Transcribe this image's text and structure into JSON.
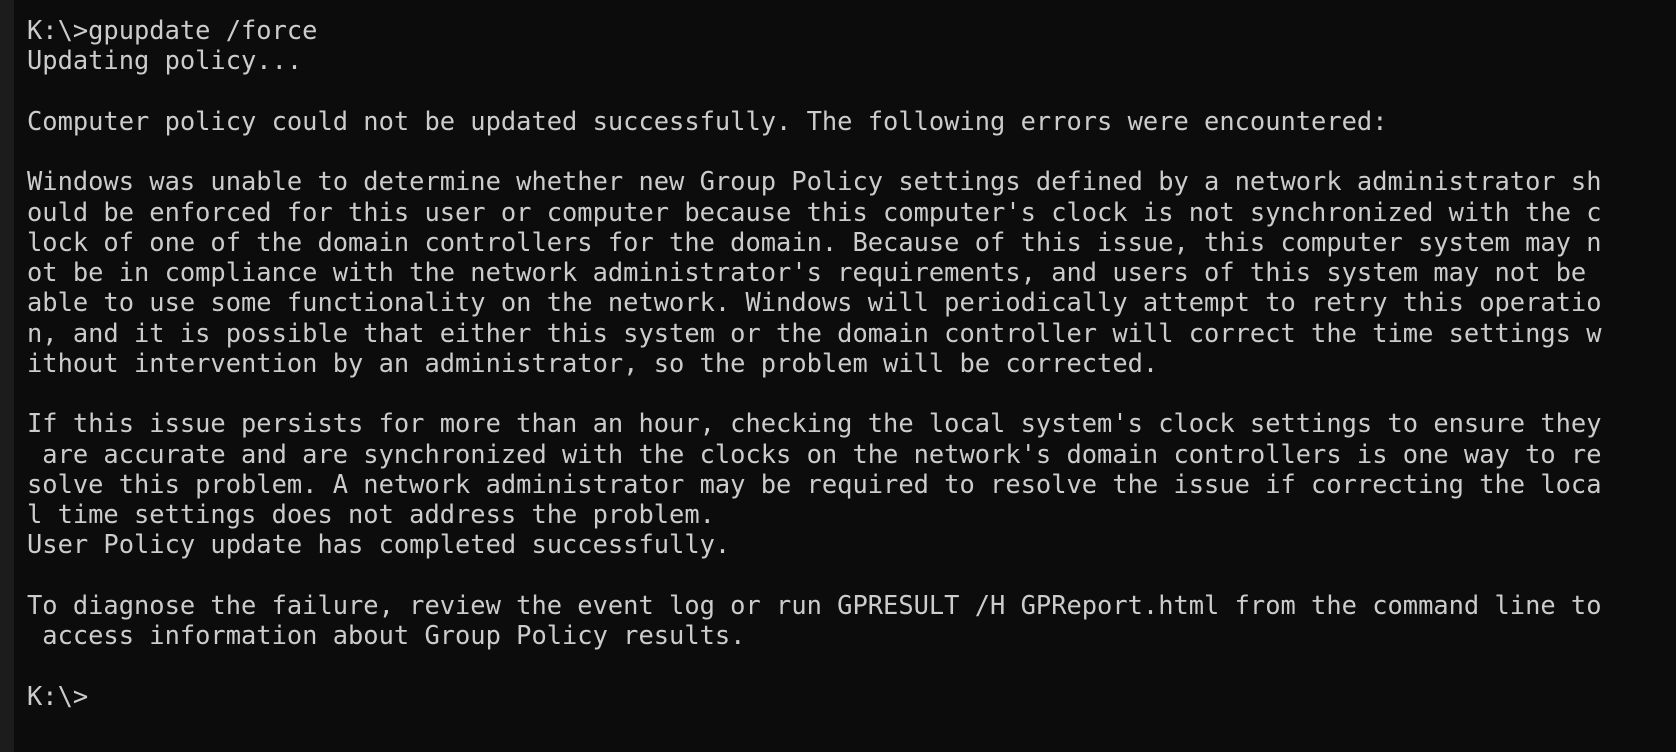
{
  "terminal": {
    "lines": [
      "K:\\>gpupdate /force",
      "Updating policy...",
      "",
      "Computer policy could not be updated successfully. The following errors were encountered:",
      "",
      "Windows was unable to determine whether new Group Policy settings defined by a network administrator sh",
      "ould be enforced for this user or computer because this computer's clock is not synchronized with the c",
      "lock of one of the domain controllers for the domain. Because of this issue, this computer system may n",
      "ot be in compliance with the network administrator's requirements, and users of this system may not be",
      "able to use some functionality on the network. Windows will periodically attempt to retry this operatio",
      "n, and it is possible that either this system or the domain controller will correct the time settings w",
      "ithout intervention by an administrator, so the problem will be corrected.",
      "",
      "If this issue persists for more than an hour, checking the local system's clock settings to ensure they",
      " are accurate and are synchronized with the clocks on the network's domain controllers is one way to re",
      "solve this problem. A network administrator may be required to resolve the issue if correcting the loca",
      "l time settings does not address the problem.",
      "User Policy update has completed successfully.",
      "",
      "To diagnose the failure, review the event log or run GPRESULT /H GPReport.html from the command line to",
      " access information about Group Policy results.",
      "",
      "K:\\>"
    ]
  }
}
